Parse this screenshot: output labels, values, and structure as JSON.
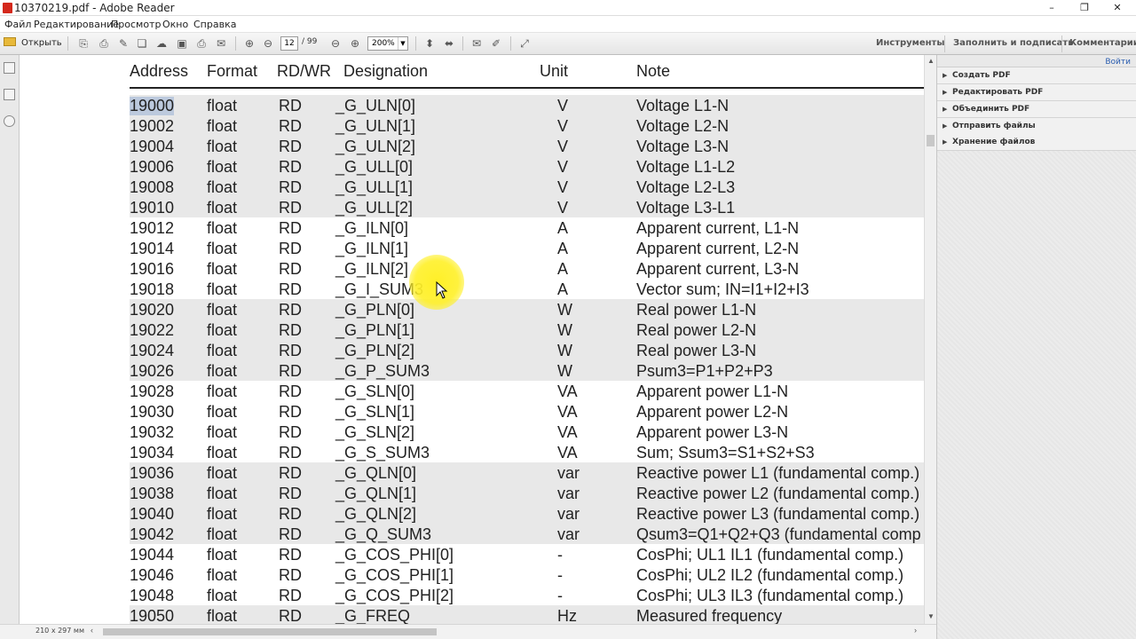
{
  "window": {
    "title": "10370219.pdf - Adobe Reader",
    "controls": [
      "–",
      "❐",
      "✕"
    ]
  },
  "menu": [
    "Файл",
    "Редактирование",
    "Просмотр",
    "Окно",
    "Справка"
  ],
  "toolbar": {
    "open_label": "Открыть",
    "page_current": "12",
    "page_total": "/ 99",
    "zoom": "200%",
    "right_links": [
      "Инструменты",
      "Заполнить и подписать",
      "Комментарии"
    ]
  },
  "right_panel": {
    "signin": "Войти",
    "items": [
      "Создать PDF",
      "Редактировать PDF",
      "Объединить PDF",
      "Отправить файлы",
      "Хранение файлов"
    ]
  },
  "status": {
    "page_size": "210 x 297 мм"
  },
  "table": {
    "headers": [
      "Address",
      "Format",
      "RD/WR",
      "Designation",
      "Unit",
      "Note"
    ],
    "rows": [
      [
        "19000",
        "float",
        "RD",
        "_G_ULN[0]",
        "V",
        "Voltage L1-N"
      ],
      [
        "19002",
        "float",
        "RD",
        "_G_ULN[1]",
        "V",
        "Voltage L2-N"
      ],
      [
        "19004",
        "float",
        "RD",
        "_G_ULN[2]",
        "V",
        "Voltage L3-N"
      ],
      [
        "19006",
        "float",
        "RD",
        "_G_ULL[0]",
        "V",
        "Voltage L1-L2"
      ],
      [
        "19008",
        "float",
        "RD",
        "_G_ULL[1]",
        "V",
        "Voltage L2-L3"
      ],
      [
        "19010",
        "float",
        "RD",
        "_G_ULL[2]",
        "V",
        "Voltage L3-L1"
      ],
      [
        "19012",
        "float",
        "RD",
        "_G_ILN[0]",
        "A",
        "Apparent current, L1-N"
      ],
      [
        "19014",
        "float",
        "RD",
        "_G_ILN[1]",
        "A",
        "Apparent current, L2-N"
      ],
      [
        "19016",
        "float",
        "RD",
        "_G_ILN[2]",
        "A",
        "Apparent current, L3-N"
      ],
      [
        "19018",
        "float",
        "RD",
        "_G_I_SUM3",
        "A",
        "Vector sum; IN=I1+I2+I3"
      ],
      [
        "19020",
        "float",
        "RD",
        "_G_PLN[0]",
        "W",
        "Real power L1-N"
      ],
      [
        "19022",
        "float",
        "RD",
        "_G_PLN[1]",
        "W",
        "Real power L2-N"
      ],
      [
        "19024",
        "float",
        "RD",
        "_G_PLN[2]",
        "W",
        "Real power L3-N"
      ],
      [
        "19026",
        "float",
        "RD",
        "_G_P_SUM3",
        "W",
        "Psum3=P1+P2+P3"
      ],
      [
        "19028",
        "float",
        "RD",
        "_G_SLN[0]",
        "VA",
        "Apparent power L1-N"
      ],
      [
        "19030",
        "float",
        "RD",
        "_G_SLN[1]",
        "VA",
        "Apparent power L2-N"
      ],
      [
        "19032",
        "float",
        "RD",
        "_G_SLN[2]",
        "VA",
        "Apparent power L3-N"
      ],
      [
        "19034",
        "float",
        "RD",
        "_G_S_SUM3",
        "VA",
        "Sum; Ssum3=S1+S2+S3"
      ],
      [
        "19036",
        "float",
        "RD",
        "_G_QLN[0]",
        "var",
        "Reactive power L1 (fundamental comp.)"
      ],
      [
        "19038",
        "float",
        "RD",
        "_G_QLN[1]",
        "var",
        "Reactive power L2 (fundamental comp.)"
      ],
      [
        "19040",
        "float",
        "RD",
        "_G_QLN[2]",
        "var",
        "Reactive power L3 (fundamental comp.)"
      ],
      [
        "19042",
        "float",
        "RD",
        "_G_Q_SUM3",
        "var",
        "Qsum3=Q1+Q2+Q3 (fundamental comp"
      ],
      [
        "19044",
        "float",
        "RD",
        "_G_COS_PHI[0]",
        "-",
        "CosPhi; UL1 IL1 (fundamental comp.)"
      ],
      [
        "19046",
        "float",
        "RD",
        "_G_COS_PHI[1]",
        "-",
        "CosPhi; UL2 IL2 (fundamental comp.)"
      ],
      [
        "19048",
        "float",
        "RD",
        "_G_COS_PHI[2]",
        "-",
        "CosPhi; UL3 IL3 (fundamental comp.)"
      ],
      [
        "19050",
        "float",
        "RD",
        "_G_FREQ",
        "Hz",
        "Measured frequency"
      ]
    ],
    "shaded_rows": [
      0,
      1,
      2,
      3,
      4,
      5,
      10,
      11,
      12,
      13,
      18,
      19,
      20,
      21,
      25
    ],
    "selected_cell": "19000"
  }
}
